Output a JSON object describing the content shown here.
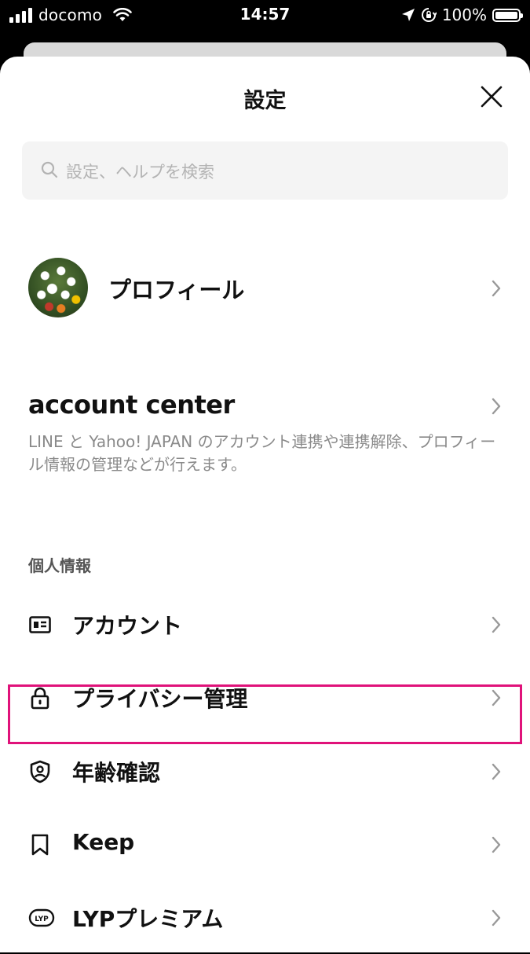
{
  "status_bar": {
    "carrier": "docomo",
    "time": "14:57",
    "battery": "100%"
  },
  "sheet": {
    "title": "設定"
  },
  "search": {
    "placeholder": "設定、ヘルプを検索"
  },
  "profile": {
    "label": "プロフィール"
  },
  "account_center": {
    "title": "account center",
    "description": "LINE と Yahoo! JAPAN のアカウント連携や連携解除、プロフィール情報の管理などが行えます。"
  },
  "personal_info": {
    "section_label": "個人情報",
    "items": [
      {
        "label": "アカウント",
        "icon": "id-card-icon"
      },
      {
        "label": "プライバシー管理",
        "icon": "lock-icon"
      },
      {
        "label": "年齢確認",
        "icon": "shield-user-icon",
        "highlighted": true
      },
      {
        "label": "Keep",
        "icon": "bookmark-icon"
      },
      {
        "label": "LYPプレミアム",
        "icon": "lyp-icon"
      }
    ]
  },
  "colors": {
    "highlight": "#e0127a",
    "sheet_bg": "#ffffff",
    "search_bg": "#f4f4f4"
  }
}
